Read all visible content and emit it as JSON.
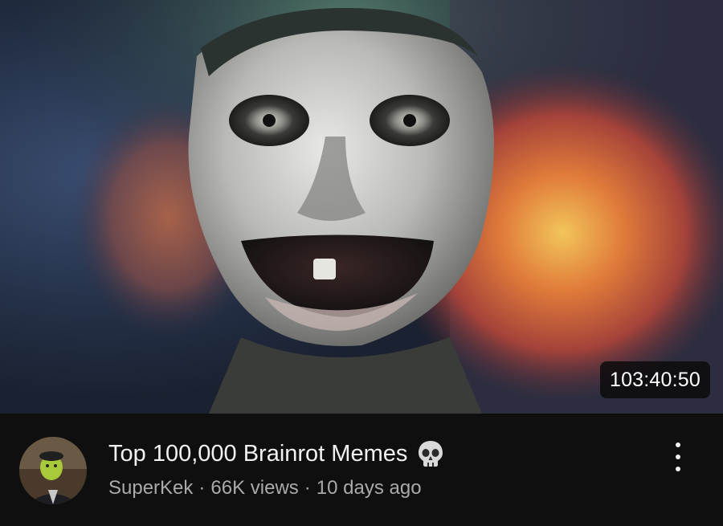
{
  "video": {
    "duration": "103:40:50",
    "title": "Top 100,000 Brainrot Memes",
    "title_icon": "skull-icon",
    "channel": "SuperKek",
    "views": "66K views",
    "age": "10 days ago",
    "separator": "·"
  },
  "icons": {
    "more": "more-options-vertical-dots-icon",
    "avatar": "channel-avatar"
  },
  "colors": {
    "background": "#0f0f0f",
    "title": "#f1f1f1",
    "subtitle": "#aaaaaa",
    "duration_bg": "#0a0a0a"
  }
}
